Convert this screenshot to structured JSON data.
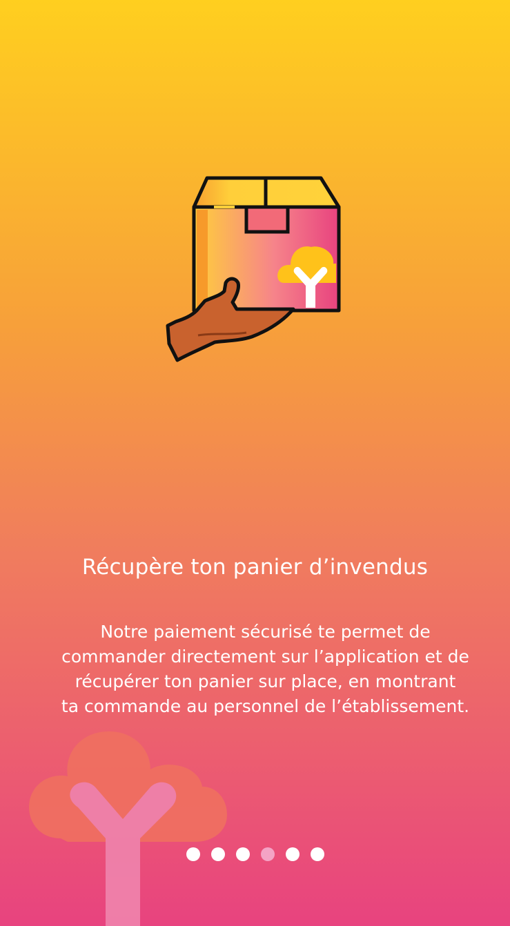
{
  "onboarding": {
    "illustration_icon": "box-in-hand-icon",
    "title": "Récupère ton panier d’invendus",
    "description_lines": [
      "Notre paiement sécurisé te permet de",
      "commander directement sur l’application et de",
      "récupérer ton panier sur place, en montrant",
      "ta commande au personnel de l’établissement."
    ],
    "background_tree_icon": "tree-y-logo-icon",
    "pagination": {
      "total": 6,
      "active_index": 3
    }
  },
  "colors": {
    "gradient_top": "#ffcf1f",
    "gradient_middle": "#f7a03a",
    "gradient_lower": "#f07c5e",
    "gradient_bottom": "#e8437f",
    "text": "#ffffff",
    "dot": "#ffffff",
    "dot_active": "#f4a3c5"
  }
}
